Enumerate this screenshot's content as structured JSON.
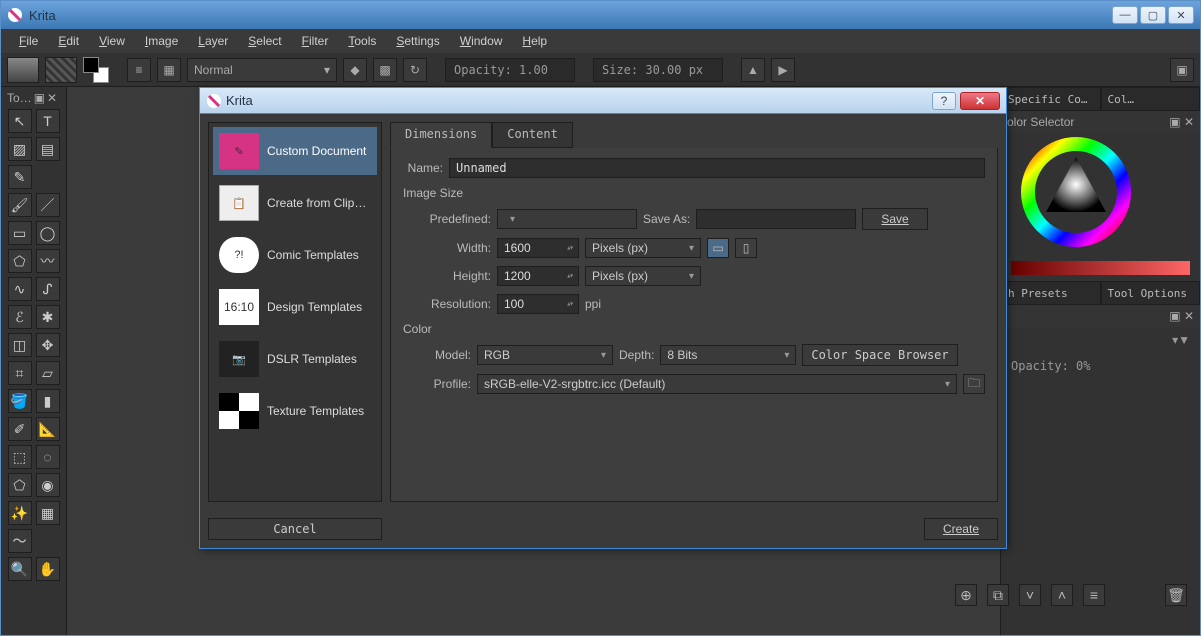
{
  "app": {
    "title": "Krita"
  },
  "menu": {
    "items": [
      "File",
      "Edit",
      "View",
      "Image",
      "Layer",
      "Select",
      "Filter",
      "Tools",
      "Settings",
      "Window",
      "Help"
    ]
  },
  "top_toolbar": {
    "blend_mode": "Normal",
    "opacity_label": "Opacity:  1.00",
    "size_label": "Size:  30.00 px"
  },
  "left_panel": {
    "title": "To…"
  },
  "right_dock": {
    "tab1": "Specific Co…",
    "tab2": "Col…",
    "selector_title": "olor Selector",
    "tab3": "h Presets",
    "tab4": "Tool Options",
    "opacity_label": "Opacity:  0%"
  },
  "dialog": {
    "title": "Krita",
    "sidebar": {
      "items": [
        {
          "label": "Custom Document"
        },
        {
          "label": "Create from Clip…"
        },
        {
          "label": "Comic Templates"
        },
        {
          "label": "Design Templates",
          "icon_text": "16:10"
        },
        {
          "label": "DSLR Templates"
        },
        {
          "label": "Texture Templates"
        }
      ]
    },
    "tabs": {
      "dimensions": "Dimensions",
      "content": "Content"
    },
    "form": {
      "name_label": "Name:",
      "name_value": "Unnamed",
      "image_size_label": "Image Size",
      "predefined_label": "Predefined:",
      "saveas_label": "Save As:",
      "save_btn": "Save",
      "width_label": "Width:",
      "width_value": "1600",
      "width_unit": "Pixels (px)",
      "height_label": "Height:",
      "height_value": "1200",
      "height_unit": "Pixels (px)",
      "resolution_label": "Resolution:",
      "resolution_value": "100",
      "resolution_unit": "ppi",
      "color_label": "Color",
      "model_label": "Model:",
      "model_value": "RGB",
      "depth_label": "Depth:",
      "depth_value": "8 Bits",
      "csb_btn": "Color Space Browser",
      "profile_label": "Profile:",
      "profile_value": "sRGB-elle-V2-srgbtrc.icc (Default)"
    },
    "cancel": "Cancel",
    "create": "Create"
  }
}
